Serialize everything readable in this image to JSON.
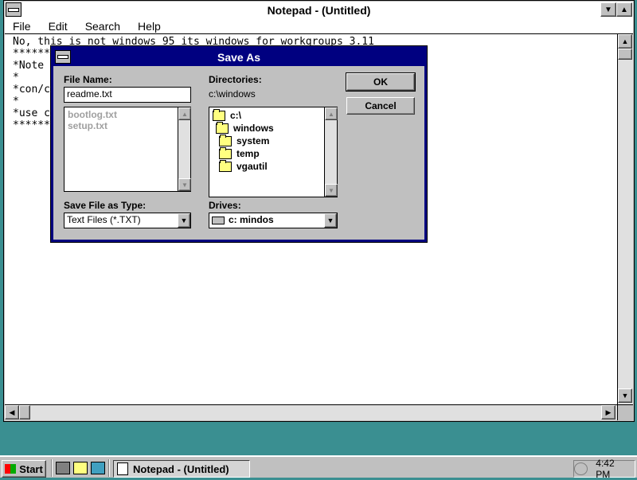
{
  "notepad": {
    "title": "Notepad - (Untitled)",
    "menu": [
      "File",
      "Edit",
      "Search",
      "Help"
    ],
    "text_lines": [
      "No, this is not windows 95 its windows for workgroups 3.11",
      "",
      "******",
      "*Note",
      "*",
      "*con/c",
      "*",
      "*use c",
      "******"
    ]
  },
  "dialog": {
    "title": "Save As",
    "file_name_label": "File Name:",
    "file_name_value": "readme.txt",
    "files": [
      "bootlog.txt",
      "setup.txt"
    ],
    "directories_label": "Directories:",
    "current_dir": "c:\\windows",
    "dir_tree": [
      "c:\\",
      "windows",
      "system",
      "temp",
      "vgautil"
    ],
    "save_type_label": "Save File as Type:",
    "save_type_value": "Text Files (*.TXT)",
    "drives_label": "Drives:",
    "drive_value": "c: mindos",
    "ok_label": "OK",
    "cancel_label": "Cancel"
  },
  "taskbar": {
    "start_label": "Start",
    "task_label": "Notepad - (Untitled)",
    "clock": "4:42 PM"
  },
  "colors": {
    "desktop": "#3a8f91",
    "dialog_title": "#000080"
  }
}
